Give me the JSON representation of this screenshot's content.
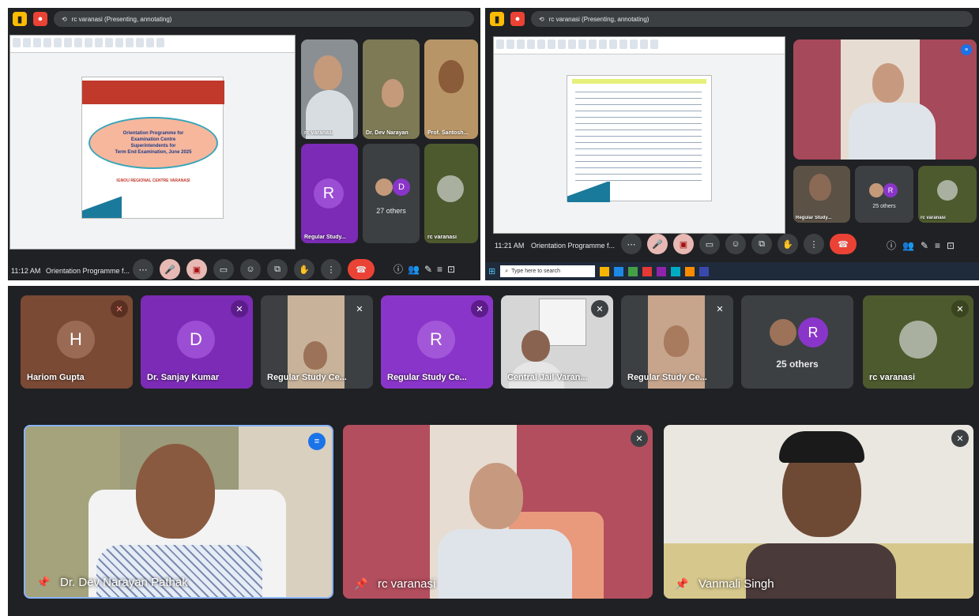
{
  "left_screen": {
    "presenting_label": "rc varanasi (Presenting, annotating)",
    "time": "11:12 AM",
    "meeting_title": "Orientation Programme f...",
    "slide": {
      "line1": "Orientation Programme for",
      "line2": "Examination Centre",
      "line3": "Superintendents for",
      "line4": "Term End Examination, June 2025",
      "footer": "IGNOU REGIONAL CENTRE VARANASI"
    },
    "tiles": [
      {
        "name": "rc varanasi"
      },
      {
        "name": "Dr. Dev Narayan"
      },
      {
        "name": "Prof. Santosh..."
      },
      {
        "name": "Regular Study...",
        "initial": "R"
      },
      {
        "name": "27 others",
        "initial": "D"
      },
      {
        "name": "rc varanasi"
      }
    ]
  },
  "right_screen": {
    "presenting_label": "rc varanasi (Presenting, annotating)",
    "time": "11:21 AM",
    "meeting_title": "Orientation Programme f...",
    "tiles": [
      {
        "name": "Regular Study..."
      },
      {
        "name": "25 others"
      },
      {
        "name": "rc varanasi"
      }
    ],
    "taskbar_search": "Type here to search"
  },
  "bottom": {
    "tiles": [
      {
        "name": "Hariom Gupta",
        "initial": "H",
        "color": "#7a4a35"
      },
      {
        "name": "Dr. Sanjay Kumar",
        "initial": "D",
        "color": "#7b2bb5"
      },
      {
        "name": "Regular Study Ce..."
      },
      {
        "name": "Regular Study Ce...",
        "initial": "R",
        "color": "#8a35c9"
      },
      {
        "name": "Central Jail Varan..."
      },
      {
        "name": "Regular Study Ce..."
      },
      {
        "name": "25 others",
        "initial": "R"
      },
      {
        "name": "rc varanasi"
      }
    ],
    "speakers": [
      {
        "name": "Dr. Dev Narayan Pathak"
      },
      {
        "name": "rc varanasi"
      },
      {
        "name": "Vanmali Singh"
      }
    ]
  },
  "colors": {
    "meet_bg": "#202124",
    "tile_bg": "#3c4043",
    "end_call": "#ea4335",
    "purple": "#8a35c9"
  }
}
